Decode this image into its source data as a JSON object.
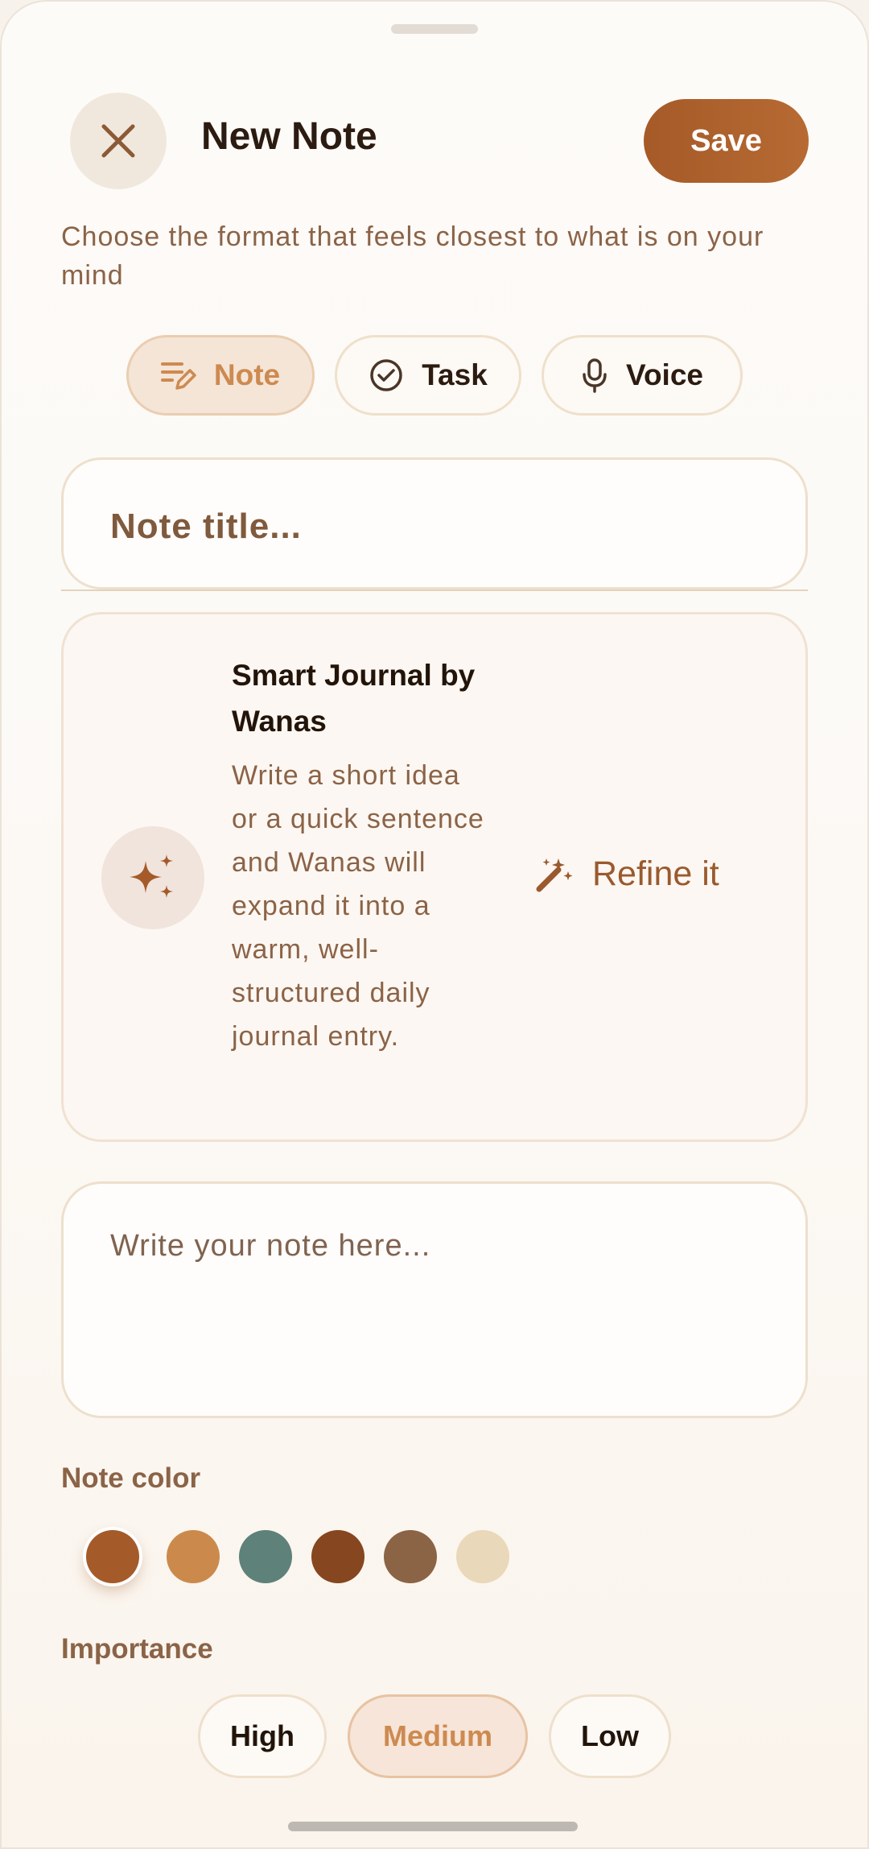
{
  "header": {
    "title": "New Note",
    "save_label": "Save",
    "close_icon": "close-icon"
  },
  "subtitle": "Choose the format that feels closest to what is on your mind",
  "note_types": [
    {
      "label": "Note",
      "icon": "note-edit-icon",
      "active": true
    },
    {
      "label": "Task",
      "icon": "check-circle-icon",
      "active": false
    },
    {
      "label": "Voice",
      "icon": "microphone-icon",
      "active": false
    }
  ],
  "title_input": {
    "placeholder": "Note title..."
  },
  "smart_journal": {
    "title": "Smart Journal by Wanas",
    "description": "Write a short idea or a quick sentence and Wanas will expand it into a warm, well-structured daily journal entry.",
    "icon": "sparkles-icon",
    "action_label": "Refine it",
    "action_icon": "magic-wand-icon"
  },
  "body_input": {
    "placeholder": "Write your note here..."
  },
  "note_color": {
    "label": "Note color",
    "colors": [
      "#a55a2a",
      "#cb8a4c",
      "#5e8179",
      "#86461f",
      "#8b6345",
      "#e9d8ba"
    ],
    "selected": 0
  },
  "importance": {
    "label": "Importance",
    "options": [
      "High",
      "Medium",
      "Low"
    ],
    "selected": "Medium"
  },
  "accent_color": "#a55a28"
}
